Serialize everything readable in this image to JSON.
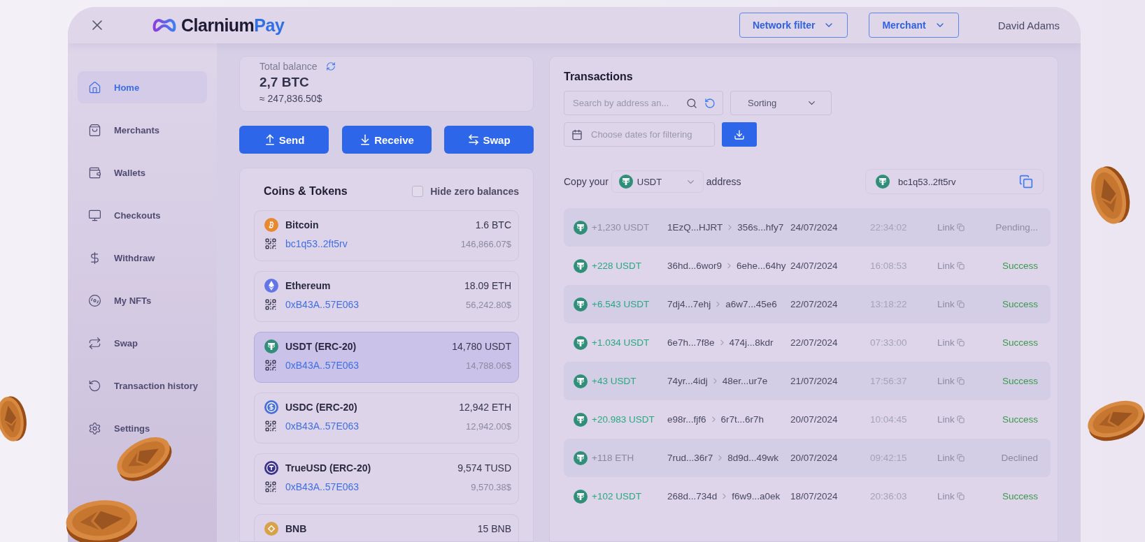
{
  "header": {
    "brand": "Clarnium",
    "brand_accent": "Pay",
    "filters": [
      "Network filter",
      "Merchant"
    ],
    "user": "David Adams"
  },
  "sidebar": {
    "items": [
      {
        "label": "Home",
        "selected": true
      },
      {
        "label": "Merchants",
        "selected": false
      },
      {
        "label": "Wallets",
        "selected": false
      },
      {
        "label": "Checkouts",
        "selected": false
      },
      {
        "label": "Withdraw",
        "selected": false
      },
      {
        "label": "My NFTs",
        "selected": false
      },
      {
        "label": "Swap",
        "selected": false
      },
      {
        "label": "Transaction history",
        "selected": false
      },
      {
        "label": "Settings",
        "selected": false
      }
    ]
  },
  "balance": {
    "label": "Total balance",
    "amount": "2,7 BTC",
    "fiat": "≈ 247,836.50$"
  },
  "actions": [
    "Send",
    "Receive",
    "Swap"
  ],
  "tokens": {
    "title": "Coins & Tokens",
    "hide_zero": {
      "label": "Hide zero balances",
      "checked": false
    },
    "items": [
      {
        "kind": "btc",
        "name": "Bitcoin",
        "address": "bc1q53..2ft5rv",
        "amount": "1.6 BTC",
        "fiat": "146,866.07$",
        "selected": false
      },
      {
        "kind": "eth",
        "name": "Ethereum",
        "address": "0xB43A..57E063",
        "amount": "18.09 ETH",
        "fiat": "56,242.80$",
        "selected": false
      },
      {
        "kind": "usdt",
        "name": "USDT (ERC-20)",
        "address": "0xB43A..57E063",
        "amount": "14,780 USDT",
        "fiat": "14,788.06$",
        "selected": true
      },
      {
        "kind": "usdc",
        "name": "USDC (ERC-20)",
        "address": "0xB43A..57E063",
        "amount": "12,942 ETH",
        "fiat": "12,942.00$",
        "selected": false
      },
      {
        "kind": "tusd",
        "name": "TrueUSD (ERC-20)",
        "address": "0xB43A..57E063",
        "amount": "9,574 TUSD",
        "fiat": "9,570.38$",
        "selected": false
      },
      {
        "kind": "bnb",
        "name": "BNB",
        "amount": "15 BNB",
        "selected": false
      }
    ]
  },
  "transactions": {
    "title": "Transactions",
    "search": {
      "placeholder": "Search by address an..."
    },
    "sorting": "Sorting",
    "dates": {
      "placeholder": "Choose dates for filtering"
    },
    "copy": {
      "prefix": "Copy your",
      "coin": "USDT",
      "suffix": "address",
      "address": "bc1q53..2ft5rv"
    },
    "rows": [
      {
        "amount": "+1,230 USDT",
        "from": "1EzQ...HJRT",
        "to": "356s...hfy7",
        "date": "24/07/2024",
        "time": "22:34:02",
        "link": "Link",
        "status": "Pending...",
        "kind": "pending"
      },
      {
        "amount": "+228 USDT",
        "from": "36hd...6wor9",
        "to": "6ehe...64hy",
        "date": "24/07/2024",
        "time": "16:08:53",
        "link": "Link",
        "status": "Success",
        "kind": "success"
      },
      {
        "amount": "+6.543 USDT",
        "from": "7dj4...7ehj",
        "to": "a6w7...45e6",
        "date": "22/07/2024",
        "time": "13:18:22",
        "link": "Link",
        "status": "Success",
        "kind": "success"
      },
      {
        "amount": "+1.034 USDT",
        "from": "6e7h...7f8e",
        "to": "474j...8kdr",
        "date": "22/07/2024",
        "time": "07:33:00",
        "link": "Link",
        "status": "Success",
        "kind": "success"
      },
      {
        "amount": "+43 USDT",
        "from": "74yr...4idj",
        "to": "48er...ur7e",
        "date": "21/07/2024",
        "time": "17:56:37",
        "link": "Link",
        "status": "Success",
        "kind": "success"
      },
      {
        "amount": "+20.983 USDT",
        "from": "e98r...fjf6",
        "to": "6r7t...6r7h",
        "date": "20/07/2024",
        "time": "10:04:45",
        "link": "Link",
        "status": "Success",
        "kind": "success"
      },
      {
        "amount": "+118 ETH",
        "from": "7rud...36r7",
        "to": "8d9d...49wk",
        "date": "20/07/2024",
        "time": "09:42:15",
        "link": "Link",
        "status": "Declined",
        "kind": "declined"
      },
      {
        "amount": "+102 USDT",
        "from": "268d...734d",
        "to": "f6w9...a0ek",
        "date": "18/07/2024",
        "time": "20:36:03",
        "link": "Link",
        "status": "Success",
        "kind": "success"
      }
    ]
  }
}
